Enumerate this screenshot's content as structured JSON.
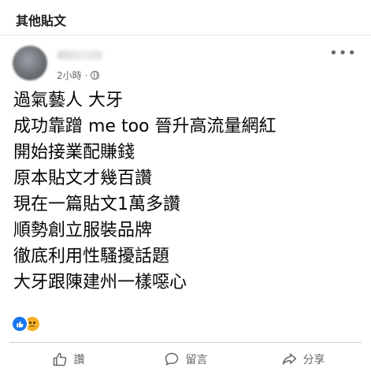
{
  "section": {
    "title": "其他貼文"
  },
  "post": {
    "time": "2小時",
    "separator": "·",
    "more_icon": "more-horizontal-icon",
    "lines": [
      "過氣藝人 大牙",
      "成功靠蹭 me too 晉升高流量網紅",
      "開始接業配賺錢",
      "原本貼文才幾百讚",
      "現在一篇貼文1萬多讚",
      "順勢創立服裝品牌",
      "徹底利用性騷擾話題",
      "大牙跟陳建州一樣噁心"
    ],
    "reactions": [
      "like-reaction-icon",
      "sad-reaction-icon"
    ]
  },
  "actions": {
    "like_label": "讚",
    "comment_label": "留言",
    "share_label": "分享"
  },
  "colors": {
    "accent": "#1877f2",
    "text": "#050505",
    "secondary_text": "#65676b"
  }
}
